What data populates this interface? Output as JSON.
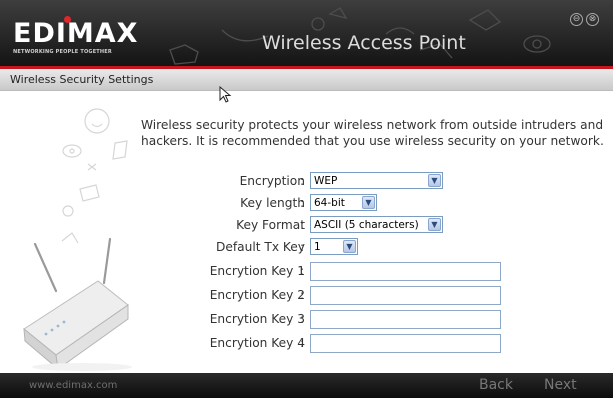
{
  "brand": {
    "logo_text": "EDIMAX",
    "tagline": "NETWORKING PEOPLE TOGETHER"
  },
  "window": {
    "title": "Wireless Access Point",
    "minimize_glyph": "⊖",
    "close_glyph": "⊗"
  },
  "section": {
    "title": "Wireless Security Settings"
  },
  "intro": "Wireless security protects your wireless network from outside intruders and hackers. It is recommended that you use wireless security on your network.",
  "form": {
    "colon": ":",
    "encryption": {
      "label": "Encryption",
      "value": "WEP"
    },
    "key_length": {
      "label": "Key length",
      "value": "64-bit"
    },
    "key_format": {
      "label": "Key Format",
      "value": "ASCII (5 characters)"
    },
    "default_tx_key": {
      "label": "Default Tx Key",
      "value": "1"
    },
    "key1": {
      "label": "Encrytion Key 1",
      "value": ""
    },
    "key2": {
      "label": "Encrytion Key 2",
      "value": ""
    },
    "key3": {
      "label": "Encrytion Key 3",
      "value": ""
    },
    "key4": {
      "label": "Encrytion Key 4",
      "value": ""
    }
  },
  "footer": {
    "website": "www.edimax.com",
    "back_label": "Back",
    "next_label": "Next"
  },
  "colors": {
    "accent_red": "#c4161c",
    "titlebar": "#1e1e1e",
    "footer_text": "#777777"
  },
  "icons": {
    "dropdown": "chevron-down-icon",
    "cursor": "mouse-pointer-icon"
  }
}
